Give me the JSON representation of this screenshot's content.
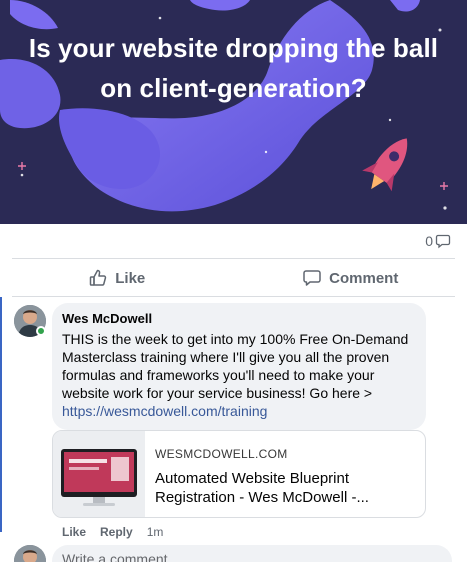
{
  "post": {
    "hero_title": "Is your website dropping the ball on client-generation?",
    "comment_count": "0",
    "actions": {
      "like_label": "Like",
      "comment_label": "Comment"
    }
  },
  "comment": {
    "author": "Wes McDowell",
    "text": "THIS is the week to get into my 100% Free On-Demand Masterclass training where I'll give you all the proven formulas and frameworks you'll need to make your website work for your service business! Go here >",
    "link": "https://wesmcdowell.com/training",
    "preview": {
      "domain": "WESMCDOWELL.COM",
      "title": "Automated Website Blueprint Registration - Wes McDowell -..."
    },
    "meta": {
      "like": "Like",
      "reply": "Reply",
      "time": "1m"
    }
  },
  "composer": {
    "placeholder": "Write a comment..."
  },
  "icons": {
    "comment_count": "comment-bubble-icon",
    "like": "thumbs-up-icon",
    "comment": "speech-bubble-icon"
  },
  "colors": {
    "hero_bg": "#2b2a55",
    "blob": "#7b6cf0",
    "link": "#385898",
    "online": "#31a24c",
    "accent_line": "#3a66c4"
  }
}
